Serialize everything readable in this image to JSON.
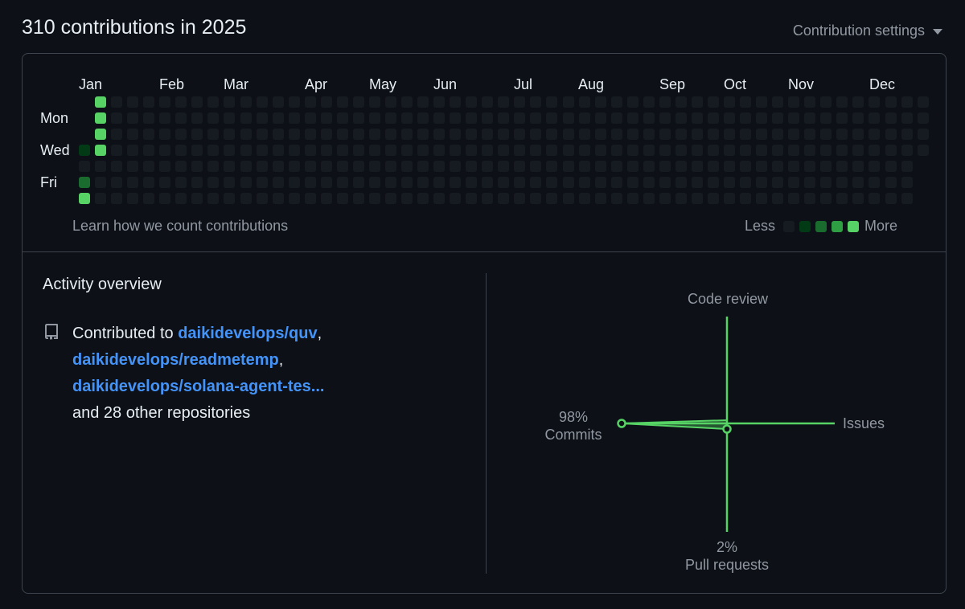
{
  "header": {
    "title": "310 contributions in 2025",
    "settings_label": "Contribution settings"
  },
  "calendar": {
    "months": [
      "Jan",
      "Feb",
      "Mar",
      "Apr",
      "May",
      "Jun",
      "Jul",
      "Aug",
      "Sep",
      "Oct",
      "Nov",
      "Dec"
    ],
    "days": [
      "Mon",
      "Wed",
      "Fri"
    ],
    "learn_link": "Learn how we count contributions",
    "legend": {
      "less": "Less",
      "more": "More"
    },
    "level_colors": [
      "#161b22",
      "#033a16",
      "#196c2e",
      "#2ea043",
      "#56d364"
    ],
    "active_cells": [
      {
        "week": 0,
        "day": 3,
        "level": 1
      },
      {
        "week": 0,
        "day": 5,
        "level": 2
      },
      {
        "week": 0,
        "day": 6,
        "level": 4
      },
      {
        "week": 1,
        "day": 0,
        "level": 4
      },
      {
        "week": 1,
        "day": 1,
        "level": 4
      },
      {
        "week": 1,
        "day": 2,
        "level": 4
      },
      {
        "week": 1,
        "day": 3,
        "level": 4
      }
    ]
  },
  "activity": {
    "title": "Activity overview",
    "prefix": "Contributed to ",
    "repos": [
      "daikidevelops/quv",
      "daikidevelops/readmetemp",
      "daikidevelops/solana-agent-tes..."
    ],
    "others": "and 28 other repositories"
  },
  "radar": {
    "accent": "#56d364",
    "code_review": {
      "label": "Code review"
    },
    "issues": {
      "label": "Issues"
    },
    "commits": {
      "label": "Commits",
      "percent": "98%"
    },
    "pull_requests": {
      "label": "Pull requests",
      "percent": "2%"
    }
  }
}
